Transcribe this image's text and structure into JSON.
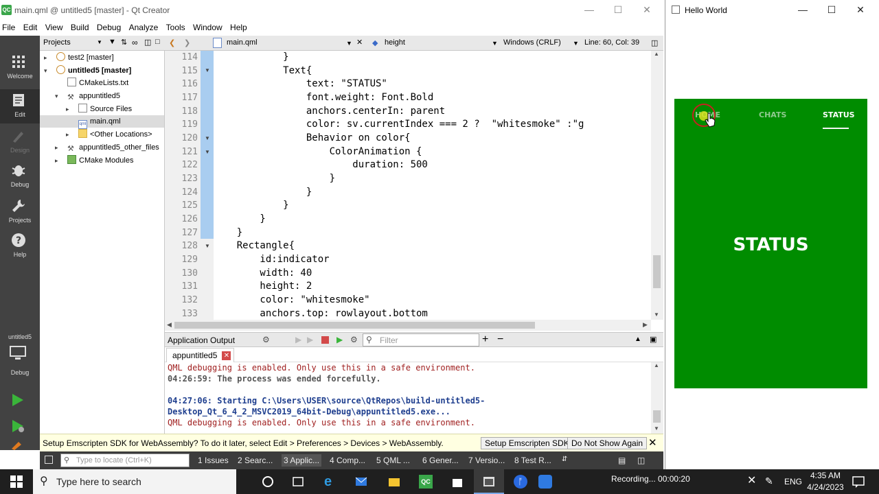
{
  "qtc": {
    "title": "main.qml @ untitled5 [master] - Qt Creator",
    "logo": "QC",
    "menu": [
      "File",
      "Edit",
      "View",
      "Build",
      "Debug",
      "Analyze",
      "Tools",
      "Window",
      "Help"
    ],
    "modes": [
      {
        "label": "Welcome",
        "icon": "grid-icon"
      },
      {
        "label": "Edit",
        "icon": "edit-icon"
      },
      {
        "label": "Design",
        "icon": "design-icon"
      },
      {
        "label": "Debug",
        "icon": "bug-icon"
      },
      {
        "label": "Projects",
        "icon": "wrench-icon"
      },
      {
        "label": "Help",
        "icon": "help-icon"
      }
    ],
    "kit": {
      "project": "untitled5",
      "label": "Debug"
    },
    "projects_panel": {
      "title": "Projects",
      "tree": [
        {
          "label": "test2 [master]",
          "bold": false
        },
        {
          "label": "untitled5 [master]",
          "bold": true
        },
        {
          "label": "CMakeLists.txt",
          "bold": false
        },
        {
          "label": "appuntitled5",
          "bold": false
        },
        {
          "label": "Source Files",
          "bold": false
        },
        {
          "label": "main.qml",
          "bold": false
        },
        {
          "label": "<Other Locations>",
          "bold": false
        },
        {
          "label": "appuntitled5_other_files",
          "bold": false
        },
        {
          "label": "CMake Modules",
          "bold": false
        }
      ]
    },
    "editor": {
      "file": "main.qml",
      "symbol": "height",
      "line_ending": "Windows (CRLF)",
      "position": "Line: 60, Col: 39",
      "line_numbers": [
        "114",
        "115",
        "116",
        "117",
        "118",
        "119",
        "120",
        "121",
        "122",
        "123",
        "124",
        "125",
        "126",
        "127",
        "128",
        "129",
        "130",
        "131",
        "132",
        "133"
      ],
      "lines": [
        "            }",
        "            Text{",
        "                text: \"STATUS\"",
        "                font.weight: Font.Bold",
        "                anchors.centerIn: parent",
        "                color: sv.currentIndex === 2 ?  \"whitesmoke\" :\"g",
        "                Behavior on color{",
        "                    ColorAnimation {",
        "                        duration: 500",
        "                    }",
        "                }",
        "            }",
        "        }",
        "    }",
        "    Rectangle{",
        "        id:indicator",
        "        width: 40",
        "        height: 2",
        "        color: \"whitesmoke\"",
        "        anchors.top: rowlayout.bottom"
      ]
    },
    "output": {
      "title": "Application Output",
      "filter_placeholder": "Filter",
      "tab": "appuntitled5",
      "lines": [
        {
          "text": "QML debugging is enabled. Only use this in a safe environment.",
          "style": "red"
        },
        {
          "text": "04:26:59: The process was ended forcefully.",
          "style": "gray"
        },
        {
          "text": "",
          "style": "gray"
        },
        {
          "text": "04:27:06: Starting C:\\Users\\USER\\source\\QtRepos\\build-untitled5-",
          "style": "blue"
        },
        {
          "text": "Desktop_Qt_6_4_2_MSVC2019_64bit-Debug\\appuntitled5.exe...",
          "style": "blue"
        },
        {
          "text": "QML debugging is enabled. Only use this in a safe environment.",
          "style": "red"
        }
      ]
    },
    "infobar": {
      "message": "Setup Emscripten SDK for WebAssembly? To do it later, select Edit > Preferences > Devices > WebAssembly.",
      "setup_label": "Setup Emscripten SDK",
      "dont_show_label": "Do Not Show Again"
    },
    "statusbar": {
      "locate_placeholder": "Type to locate (Ctrl+K)",
      "panes": [
        "1  Issues",
        "2  Searc...",
        "3  Applic...",
        "4  Comp...",
        "5  QML ...",
        "6  Gener...",
        "7  Versio...",
        "8  Test R..."
      ]
    }
  },
  "hello": {
    "title": "Hello World",
    "tabs": [
      {
        "label": "HOME",
        "color": "#8fc98f"
      },
      {
        "label": "CHATS",
        "color": "#8fc98f"
      },
      {
        "label": "STATUS",
        "color": "#ffffff"
      }
    ],
    "content": "STATUS",
    "bg": "#008c00"
  },
  "taskbar": {
    "search_placeholder": "Type here to search",
    "recording": "Recording... 00:00:20",
    "lang": "ENG",
    "time": "4:35 AM",
    "date": "4/24/2023"
  }
}
